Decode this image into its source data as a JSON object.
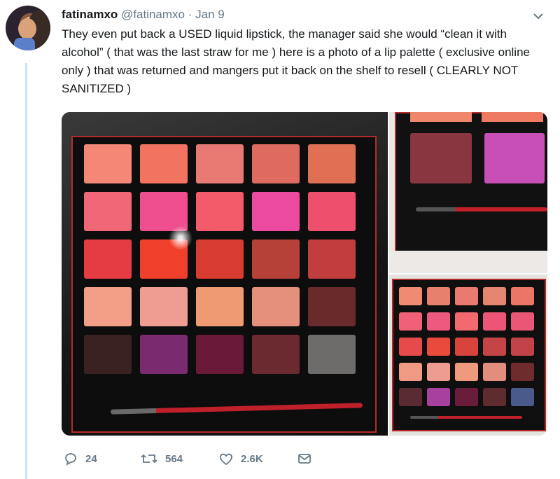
{
  "tweet": {
    "name": "fatinamxo",
    "handle": "@fatinamxo",
    "separator": "·",
    "date": "Jan 9",
    "text": "They even put back a USED liquid lipstick, the manager said she would “clean it with alcohol” ( that was the last straw for me ) here is a photo of a lip palette ( exclusive online only ) that was returned and mangers put it back on the shelf to resell ( CLEARLY NOT SANITIZED )"
  },
  "actions": {
    "replies": "24",
    "retweets": "564",
    "likes": "2.6K"
  },
  "icons": [
    "chevron-down-icon",
    "reply-icon",
    "retweet-icon",
    "like-icon",
    "direct-message-icon"
  ],
  "colors": {
    "thread_line": "#c4e6f7",
    "muted_text": "#657786",
    "text": "#14171a"
  },
  "palette_main_colors": [
    [
      "#f48775",
      "#f2735f",
      "#e97a73",
      "#dd6b5f",
      "#e07054"
    ],
    [
      "#f26778",
      "#f04f8f",
      "#f35a6a",
      "#ec4aa0",
      "#ee4f6c"
    ],
    [
      "#e53c43",
      "#f0402c",
      "#d83b2f",
      "#b64139",
      "#c23d3e"
    ],
    [
      "#f39f87",
      "#ef9c93",
      "#f09a74",
      "#e5907c",
      "#6a2a2c"
    ],
    [
      "#3b2222",
      "#7a2a6e",
      "#6a1a38",
      "#6a2a30",
      "#6e6b6b"
    ]
  ],
  "palette_tr_colors": [
    "#8a3640",
    "#c84fb5"
  ],
  "palette_br_colors": [
    [
      "#f08a70",
      "#e8806e",
      "#e87a6f",
      "#e3856f",
      "#eb7668"
    ],
    [
      "#f06077",
      "#ee5980",
      "#f26a6f",
      "#ec5575",
      "#e95676"
    ],
    [
      "#e64a4b",
      "#ea4a3b",
      "#d8443b",
      "#c54546",
      "#c24249"
    ],
    [
      "#f19a83",
      "#ee9b92",
      "#ef9a7c",
      "#e38d7d",
      "#6f2c2d"
    ],
    [
      "#5a2b32",
      "#a840a0",
      "#6a1d3a",
      "#5e2b2e",
      "#4a5a8a"
    ]
  ]
}
